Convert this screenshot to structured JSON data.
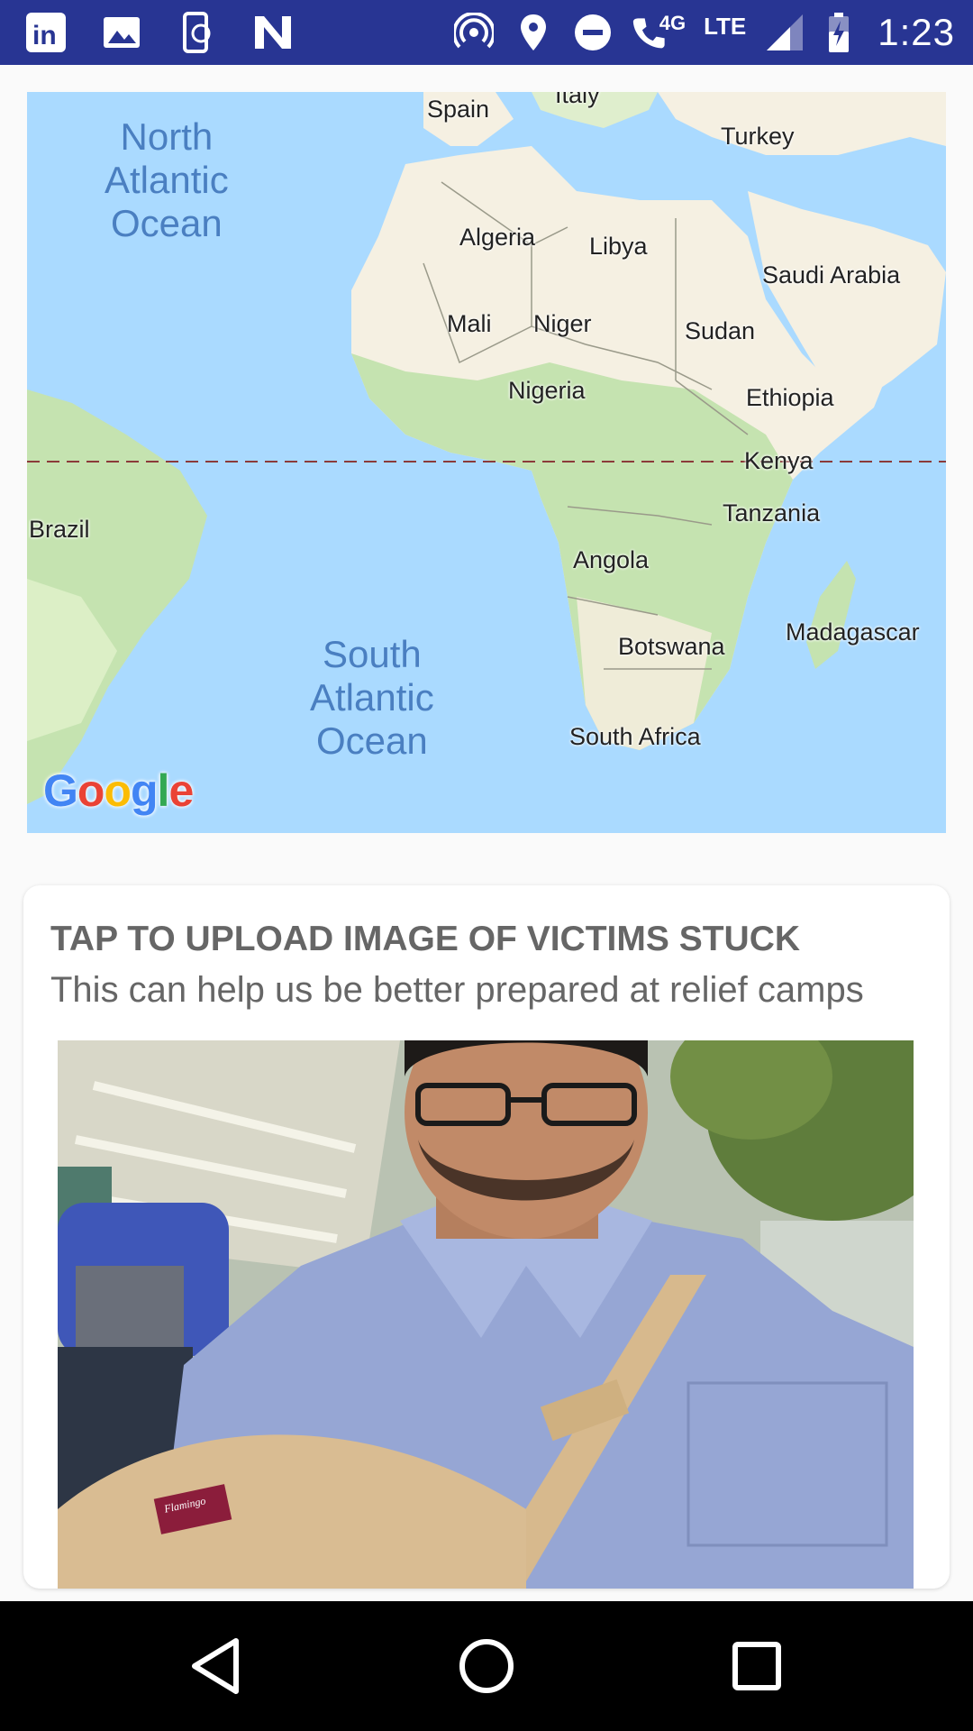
{
  "status_bar": {
    "left_icons": [
      "linkedin-icon",
      "gallery-icon",
      "phone-sync-icon",
      "n-icon"
    ],
    "right_icons": [
      "hotspot-icon",
      "location-icon",
      "do-not-disturb-icon",
      "wifi-calling-icon",
      "lte-icon",
      "signal-icon",
      "battery-charging-icon"
    ],
    "network_type": "4G",
    "lte_label": "LTE",
    "time": "1:23",
    "background": "#283593"
  },
  "map": {
    "oceans": [
      {
        "name": "north-atlantic",
        "lines": [
          "North",
          "Atlantic",
          "Ocean"
        ]
      },
      {
        "name": "south-atlantic",
        "lines": [
          "South",
          "Atlantic",
          "Ocean"
        ]
      }
    ],
    "countries": [
      "Italy",
      "Spain",
      "Turkey",
      "Algeria",
      "Libya",
      "Saudi Arabia",
      "Mali",
      "Niger",
      "Sudan",
      "Nigeria",
      "Ethiopia",
      "Kenya",
      "Brazil",
      "Tanzania",
      "Angola",
      "Madagascar",
      "Botswana",
      "South Africa"
    ],
    "logo": "Google",
    "water_color": "#aadaff",
    "land_color": "#f5f0e2",
    "vegetation_color": "#c5e3b0"
  },
  "card": {
    "title": "TAP TO UPLOAD IMAGE OF VICTIMS STUCK",
    "subtitle": "This can help us be better prepared at relief camps",
    "photo_badge": "Flamingo"
  },
  "nav_bar": {
    "buttons": [
      "back-icon",
      "home-icon",
      "recents-icon"
    ]
  }
}
